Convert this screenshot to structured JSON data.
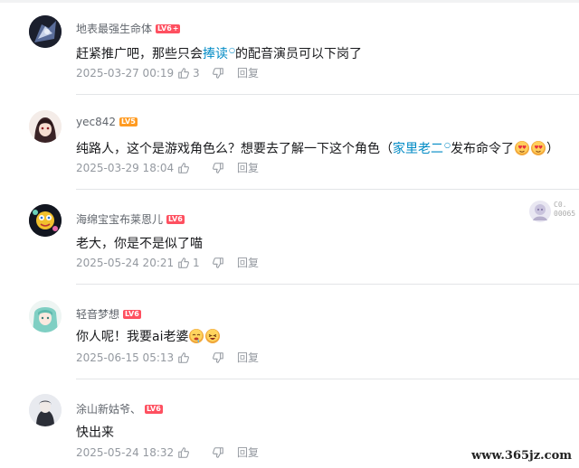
{
  "comments": [
    {
      "username": "地表最强生命体",
      "level": "LV6",
      "level_plus": "+",
      "content_before": "赶紧推广吧，那些只会",
      "content_link": "捧读",
      "content_after": "的配音演员可以下岗了",
      "time": "2025-03-27 00:19",
      "likes": "3",
      "reply": "回复"
    },
    {
      "username": "yec842",
      "level": "LV5",
      "content_before": "纯路人，这个是游戏角色么？想要去了解一下这个角色（",
      "content_link": "家里老二",
      "content_after": "发布命令了",
      "content_tail": "）",
      "time": "2025-03-29 18:04",
      "likes": "",
      "reply": "回复"
    },
    {
      "username": "海绵宝宝布莱恩儿",
      "level": "LV6",
      "content": "老大，你是不是似了喵",
      "time": "2025-05-24 20:21",
      "likes": "1",
      "reply": "回复"
    },
    {
      "username": "轻音梦想",
      "level": "LV6",
      "content": "你人呢！我要ai老婆",
      "time": "2025-06-15 05:13",
      "likes": "",
      "reply": "回复"
    },
    {
      "username": "涂山新姑爷、",
      "level": "LV6",
      "content": "快出来",
      "time": "2025-05-24 18:32",
      "likes": "",
      "reply": "回复"
    }
  ],
  "fan_badge": {
    "line1": "C0.",
    "line2": "00065"
  },
  "watermark": "www.365jz.com",
  "colors": {
    "link": "#008ac5",
    "level_lv6": "#fe5060",
    "level_lv5": "#ff9b22",
    "meta": "#9499a0",
    "divider": "#e3e5e7"
  },
  "icons": {
    "like": "thumbs-up-icon",
    "dislike": "thumbs-down-icon"
  }
}
